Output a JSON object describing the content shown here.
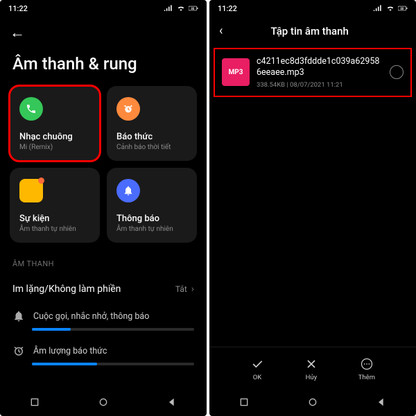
{
  "status": {
    "time": "11:22",
    "battery": "88"
  },
  "left": {
    "page_title": "Âm thanh & rung",
    "tiles": [
      {
        "title": "Nhạc chuông",
        "sub": "Mi (Remix)"
      },
      {
        "title": "Báo thức",
        "sub": "Cảnh báo thời tiết"
      },
      {
        "title": "Sự kiện",
        "sub": "Âm thanh tự nhiên"
      },
      {
        "title": "Thông báo",
        "sub": "Âm thanh tự nhiên"
      }
    ],
    "section_audio": "ÂM THANH",
    "dnd": {
      "label": "Im lặng/Không làm phiền",
      "value": "Tắt"
    },
    "slider1_label": "Cuộc gọi, nhắc nhở, thông báo",
    "slider2_label": "Âm lượng báo thức"
  },
  "right": {
    "header": "Tập tin âm thanh",
    "file": {
      "badge": "MP3",
      "name": "c4211ec8d3fddde1c039a629586eeaee.mp3",
      "size": "338.54KB",
      "date": "08/07/2021 11:21"
    },
    "actions": {
      "ok": "OK",
      "cancel": "Hủy",
      "more": "Thêm"
    }
  }
}
